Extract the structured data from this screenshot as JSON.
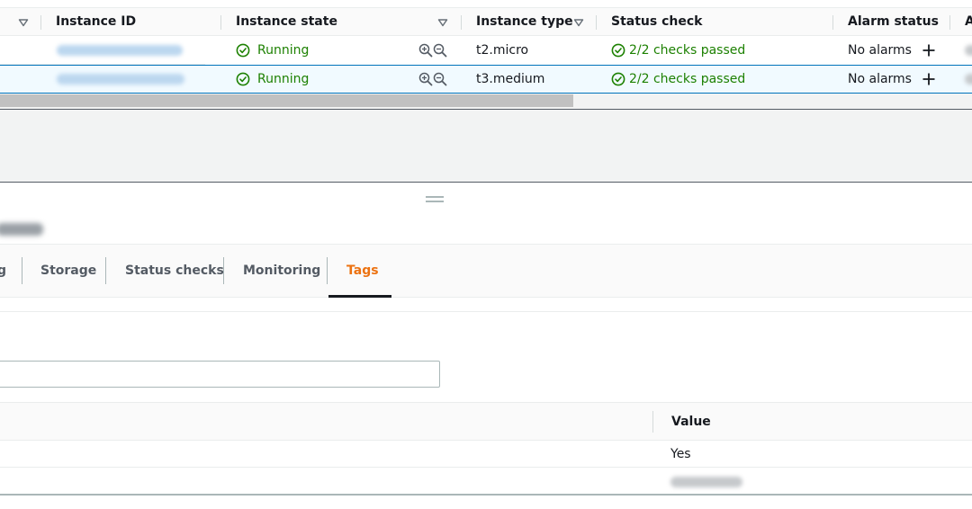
{
  "instances_table": {
    "columns": [
      "Instance ID",
      "Instance state",
      "Instance type",
      "Status check",
      "Alarm status",
      "A"
    ],
    "rows": [
      {
        "state": "Running",
        "type": "t2.micro",
        "status_check": "2/2 checks passed",
        "alarm_status": "No alarms"
      },
      {
        "state": "Running",
        "type": "t3.medium",
        "status_check": "2/2 checks passed",
        "alarm_status": "No alarms"
      }
    ]
  },
  "details": {
    "tabs": [
      {
        "label": "g",
        "active": false
      },
      {
        "label": "Storage",
        "active": false
      },
      {
        "label": "Status checks",
        "active": false
      },
      {
        "label": "Monitoring",
        "active": false
      },
      {
        "label": "Tags",
        "active": true
      }
    ],
    "tags_table": {
      "columns": [
        "Value"
      ],
      "rows": [
        {
          "value": "Yes"
        }
      ]
    }
  },
  "colors": {
    "accent": "#ec7211",
    "success": "#1d8102",
    "selected_row_bg": "#f1faff",
    "selected_row_border": "#0073bb"
  },
  "icons": [
    "sort-caret-icon",
    "check-circle-icon",
    "zoom-in-icon",
    "zoom-out-icon",
    "plus-icon",
    "resize-handle-icon"
  ]
}
